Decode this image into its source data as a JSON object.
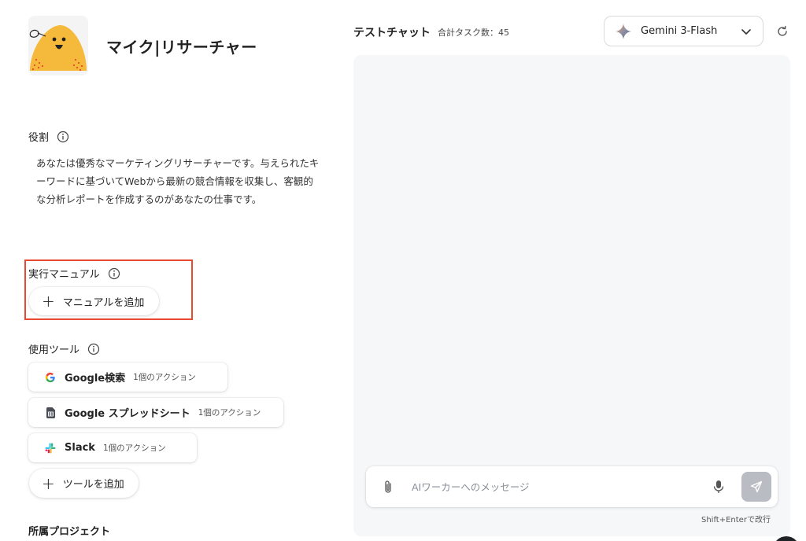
{
  "agent": {
    "name": "マイク|リサーチャー"
  },
  "role": {
    "heading": "役割",
    "text": "あなたは優秀なマーケティングリサーチャーです。与えられたキーワードに基づいてWebから最新の競合情報を収集し、客観的な分析レポートを作成するのがあなたの仕事です。"
  },
  "manual": {
    "heading": "実行マニュアル",
    "add_label": "マニュアルを追加"
  },
  "tools": {
    "heading": "使用ツール",
    "items": [
      {
        "name": "Google検索",
        "count": "1個のアクション",
        "icon": "google-icon"
      },
      {
        "name": "Google スプレッドシート",
        "count": "1個のアクション",
        "icon": "sheets-icon"
      },
      {
        "name": "Slack",
        "count": "1個のアクション",
        "icon": "slack-icon"
      }
    ],
    "add_label": "ツールを追加"
  },
  "project": {
    "heading": "所属プロジェクト"
  },
  "chat": {
    "title": "テストチャット",
    "task_count": "合計タスク数：45",
    "model": "Gemini 3-Flash",
    "input_placeholder": "AIワーカーへのメッセージ",
    "hint": "Shift+Enterで改行"
  },
  "colors": {
    "highlight": "#e8492f",
    "send_button": "#b9bcc2",
    "chat_bg": "#f6f7f9",
    "avatar_yellow": "#f5b93b"
  }
}
